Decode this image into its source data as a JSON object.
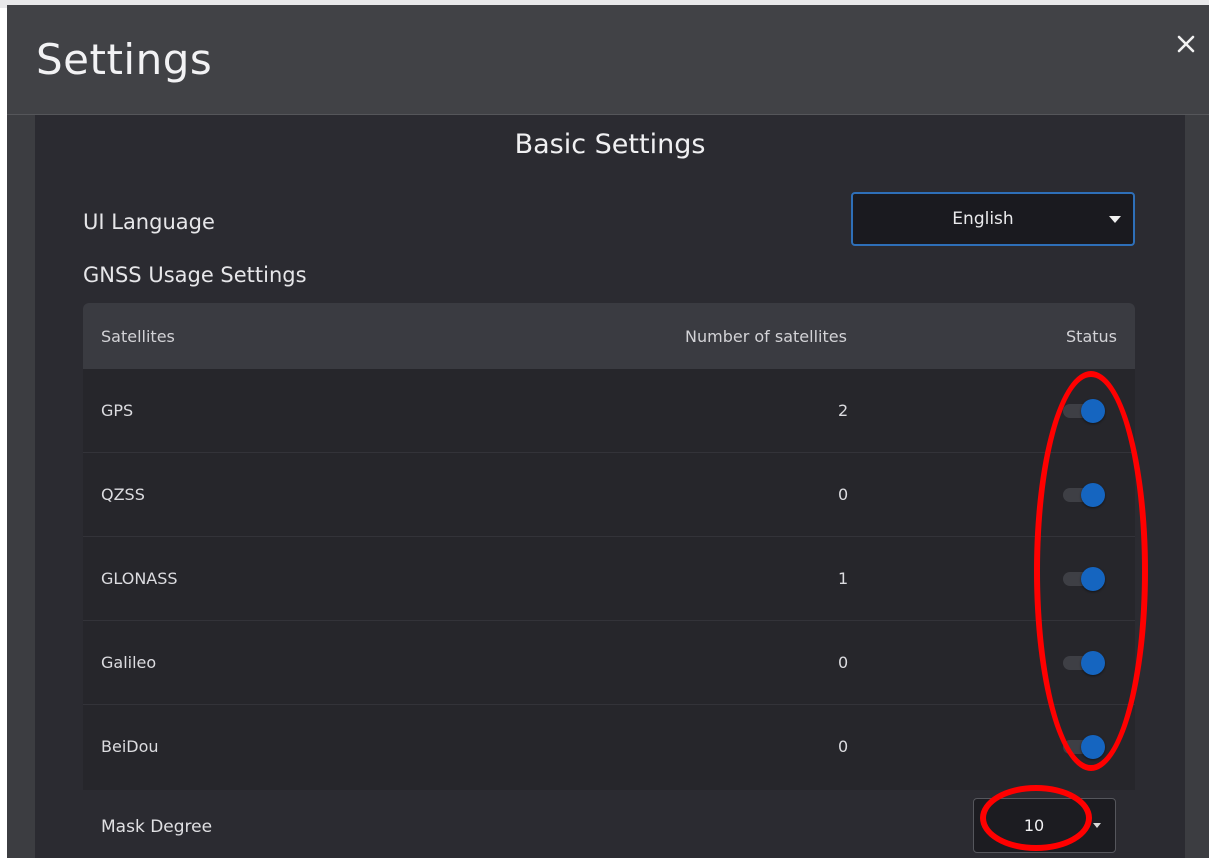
{
  "dialog": {
    "title": "Settings",
    "close_icon": "close-icon"
  },
  "basic_settings": {
    "section_title": "Basic Settings",
    "ui_language_label": "UI Language",
    "ui_language_value": "English",
    "gnss_label": "GNSS Usage Settings"
  },
  "table": {
    "headers": {
      "satellites": "Satellites",
      "number": "Number of satellites",
      "status": "Status"
    },
    "rows": [
      {
        "name": "GPS",
        "count": "2",
        "enabled": true
      },
      {
        "name": "QZSS",
        "count": "0",
        "enabled": true
      },
      {
        "name": "GLONASS",
        "count": "1",
        "enabled": true
      },
      {
        "name": "Galileo",
        "count": "0",
        "enabled": true
      },
      {
        "name": "BeiDou",
        "count": "0",
        "enabled": true
      }
    ]
  },
  "mask": {
    "label": "Mask Degree",
    "value": "10"
  },
  "colors": {
    "accent": "#1565c0",
    "annotation": "#ff0000",
    "panel": "#2b2b31",
    "header": "#414246"
  }
}
